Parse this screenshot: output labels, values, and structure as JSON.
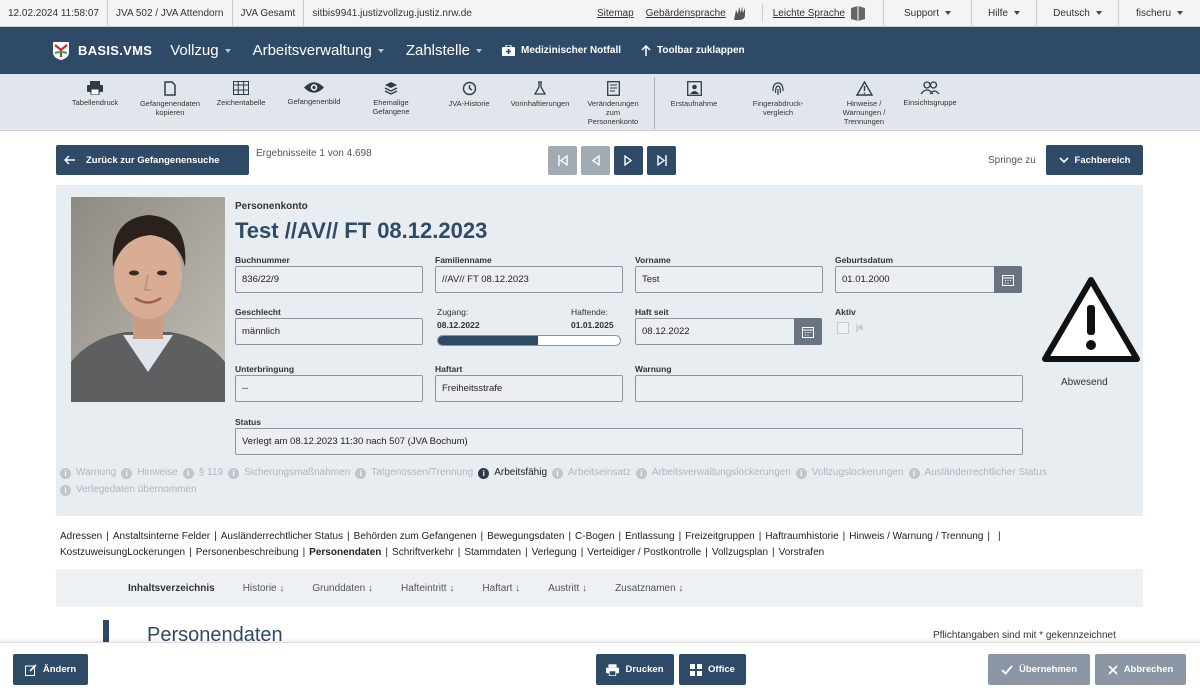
{
  "topbar": {
    "datetime": "12.02.2024 11:58:07",
    "jva": "JVA 502 / JVA Attendorn",
    "scope": "JVA Gesamt",
    "host": "sitbis9941.justizvollzug.justiz.nrw.de",
    "sitemap": "Sitemap",
    "gebaerden": "Gebärdensprache",
    "leicht": "Leichte Sprache",
    "support": "Support",
    "hilfe": "Hilfe",
    "language": "Deutsch",
    "user": "fischeru"
  },
  "nav": {
    "logo": "BASIS.VMS",
    "items": [
      "Vollzug",
      "Arbeitsverwaltung",
      "Zahlstelle"
    ],
    "notfall": "Medizinischer Notfall",
    "toolbar_toggle": "Toolbar zuklappen"
  },
  "toolbar": [
    {
      "label": "Tabellendruck",
      "icon": "printer-icon"
    },
    {
      "label": "Gefangenendaten kopieren",
      "icon": "copy-icon"
    },
    {
      "label": "Zeichentabelle",
      "icon": "table-icon"
    },
    {
      "label": "Gefangenenbild",
      "icon": "eye-icon"
    },
    {
      "label": "Ehemalige Gefangene",
      "icon": "layers-icon"
    },
    {
      "label": "JVA-Historie",
      "icon": "history-icon"
    },
    {
      "label": "Vorinhaftierungen",
      "icon": "flask-icon"
    },
    {
      "label": "Veränderungen zum Personenkonto",
      "icon": "document-icon"
    },
    {
      "label": "Erstaufnahme",
      "icon": "photo-icon"
    },
    {
      "label": "Fingerabdruck-vergleich",
      "icon": "fingerprint-icon"
    },
    {
      "label": "Hinweise / Warnungen / Trennungen",
      "icon": "warning-icon"
    },
    {
      "label": "Einsichtsgruppe",
      "icon": "group-icon"
    }
  ],
  "pagination": {
    "back": "Zurück zur Gefangenensuche",
    "result": "Ergebnisseite 1 von 4.698",
    "springe": "Springe zu",
    "fachbereich": "Fachbereich"
  },
  "person": {
    "header": "Personenkonto",
    "title": "Test //AV// FT 08.12.2023",
    "buchnummer_label": "Buchnummer",
    "buchnummer": "836/22/9",
    "familienname_label": "Familienname",
    "familienname": "//AV// FT 08.12.2023",
    "vorname_label": "Vorname",
    "vorname": "Test",
    "geburtsdatum_label": "Geburtsdatum",
    "geburtsdatum": "01.01.2000",
    "geschlecht_label": "Geschlecht",
    "geschlecht": "männlich",
    "zugang_label": "Zugang:",
    "zugang": "08.12.2022",
    "haftende_label": "Haftende:",
    "haftende": "01.01.2025",
    "haft_progress": 0.55,
    "haftseit_label": "Haft seit",
    "haftseit": "08.12.2022",
    "aktiv_label": "Aktiv",
    "aktiv_value": "ja",
    "unterbringung_label": "Unterbringung",
    "unterbringung": "--",
    "haftart_label": "Haftart",
    "haftart": "Freiheitsstrafe",
    "warnung_label": "Warnung",
    "warnung": "",
    "status_label": "Status",
    "status": "Verlegt am 08.12.2023 11:30 nach 507 (JVA Bochum)",
    "abwesend": "Abwesend"
  },
  "chips": [
    "Warnung",
    "Hinweise",
    "§ 119",
    "Sicherungsmaßnahmen",
    "Tatgenossen/Trennung",
    "Arbeitsfähig",
    "Arbeitseinsatz",
    "Arbeitsverwaltungslockerungen",
    "Vollzugslockerungen",
    "Ausländerrechtlicher Status",
    "Verlegedaten übernommen"
  ],
  "tabs": [
    "Adressen",
    "Anstaltsinterne Felder",
    "Ausländerrechtlicher Status",
    "Behörden zum Gefangenen",
    "Bewegungsdaten",
    "C-Bogen",
    "Entlassung",
    "Freizeitgruppen",
    "Haftraumhistorie",
    "Hinweis / Warnung / Trennung",
    "Kostzuweisung",
    "Lockerungen",
    "Personenbeschreibung",
    "Personendaten",
    "Schriftverkehr",
    "Stammdaten",
    "Verlegung",
    "Verteidiger / Postkontrolle",
    "Vollzugsplan",
    "Vorstrafen"
  ],
  "toc": [
    "Inhaltsverzeichnis",
    "Historie ↓",
    "Grunddaten ↓",
    "Hafteintritt ↓",
    "Haftart ↓",
    "Austritt ↓",
    "Zusatznamen ↓"
  ],
  "section": {
    "title": "Personendaten",
    "pflicht": "Pflichtangaben sind mit * gekennzeichnet"
  },
  "bottom": {
    "aendern": "Ändern",
    "drucken": "Drucken",
    "office": "Office",
    "uebernehmen": "Übernehmen",
    "abbrechen": "Abbrechen"
  }
}
